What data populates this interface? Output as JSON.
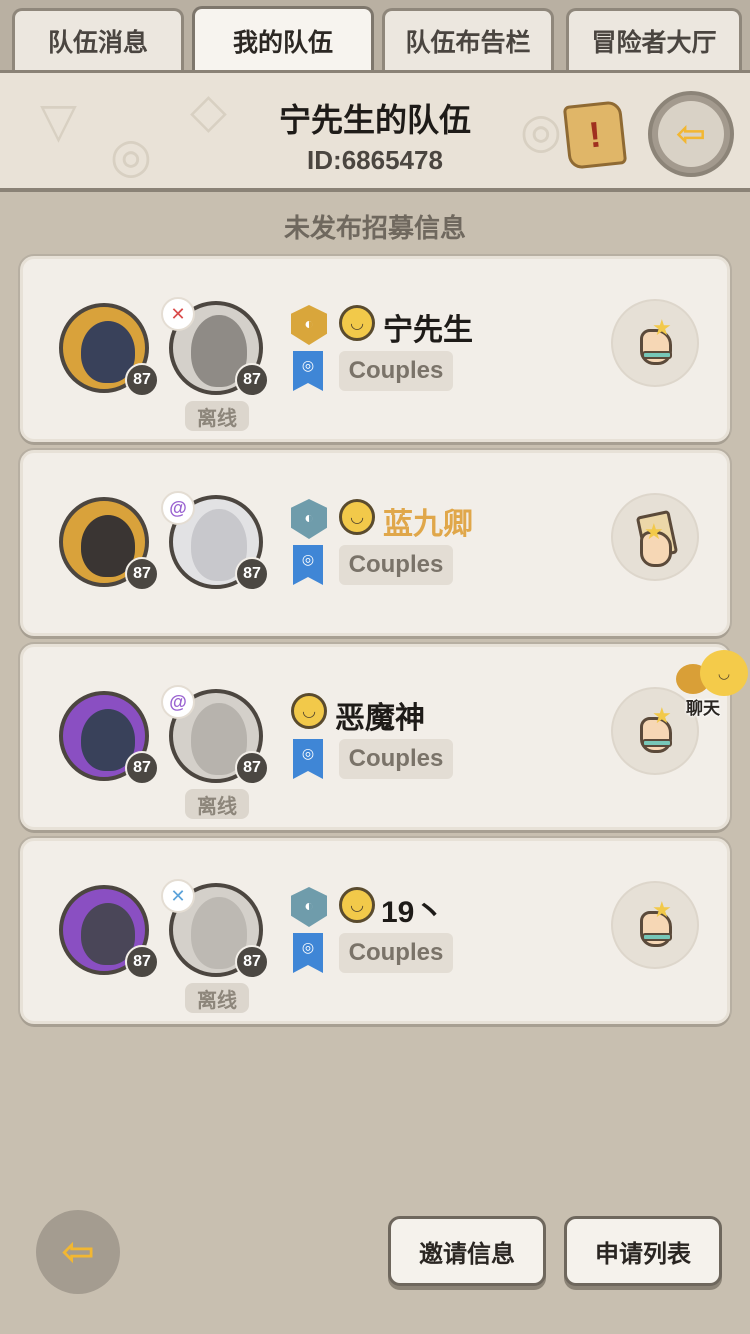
{
  "tabs": [
    {
      "label": "队伍消息",
      "active": false
    },
    {
      "label": "我的队伍",
      "active": true
    },
    {
      "label": "队伍布告栏",
      "active": false
    },
    {
      "label": "冒险者大厅",
      "active": false
    }
  ],
  "header": {
    "team_title": "宁先生的队伍",
    "team_id": "ID:6865478",
    "scroll_icon": "notice-scroll-icon",
    "exit_icon": "leave-team-icon"
  },
  "notice": "未发布招募信息",
  "members": [
    {
      "pet_level": "87",
      "char_level": "87",
      "status_icon": "heart-broken",
      "name": "宁先生",
      "name_color": "#1e1b18",
      "has_rank_shield": true,
      "rank_color": "#d9a63b",
      "tag": "Couples",
      "offline_label": "离线",
      "action": "rate-hand"
    },
    {
      "pet_level": "87",
      "char_level": "87",
      "status_icon": "swirl",
      "name": "蓝九卿",
      "name_color": "#e0a74a",
      "has_rank_shield": true,
      "rank_color": "#6f9cab",
      "tag": "Couples",
      "offline_label": "",
      "action": "card-hand"
    },
    {
      "pet_level": "87",
      "char_level": "87",
      "status_icon": "swirl",
      "name": "恶魔神",
      "name_color": "#1e1b18",
      "has_rank_shield": false,
      "rank_color": "",
      "tag": "Couples",
      "offline_label": "离线",
      "action": "rate-hand"
    },
    {
      "pet_level": "87",
      "char_level": "87",
      "status_icon": "sword",
      "name": "19丶",
      "name_color": "#1e1b18",
      "has_rank_shield": true,
      "rank_color": "#6f9cab",
      "tag": "Couples",
      "offline_label": "离线",
      "action": "rate-hand"
    }
  ],
  "chat_label": "聊天",
  "bottom": {
    "invite_label": "邀请信息",
    "apply_label": "申请列表"
  }
}
